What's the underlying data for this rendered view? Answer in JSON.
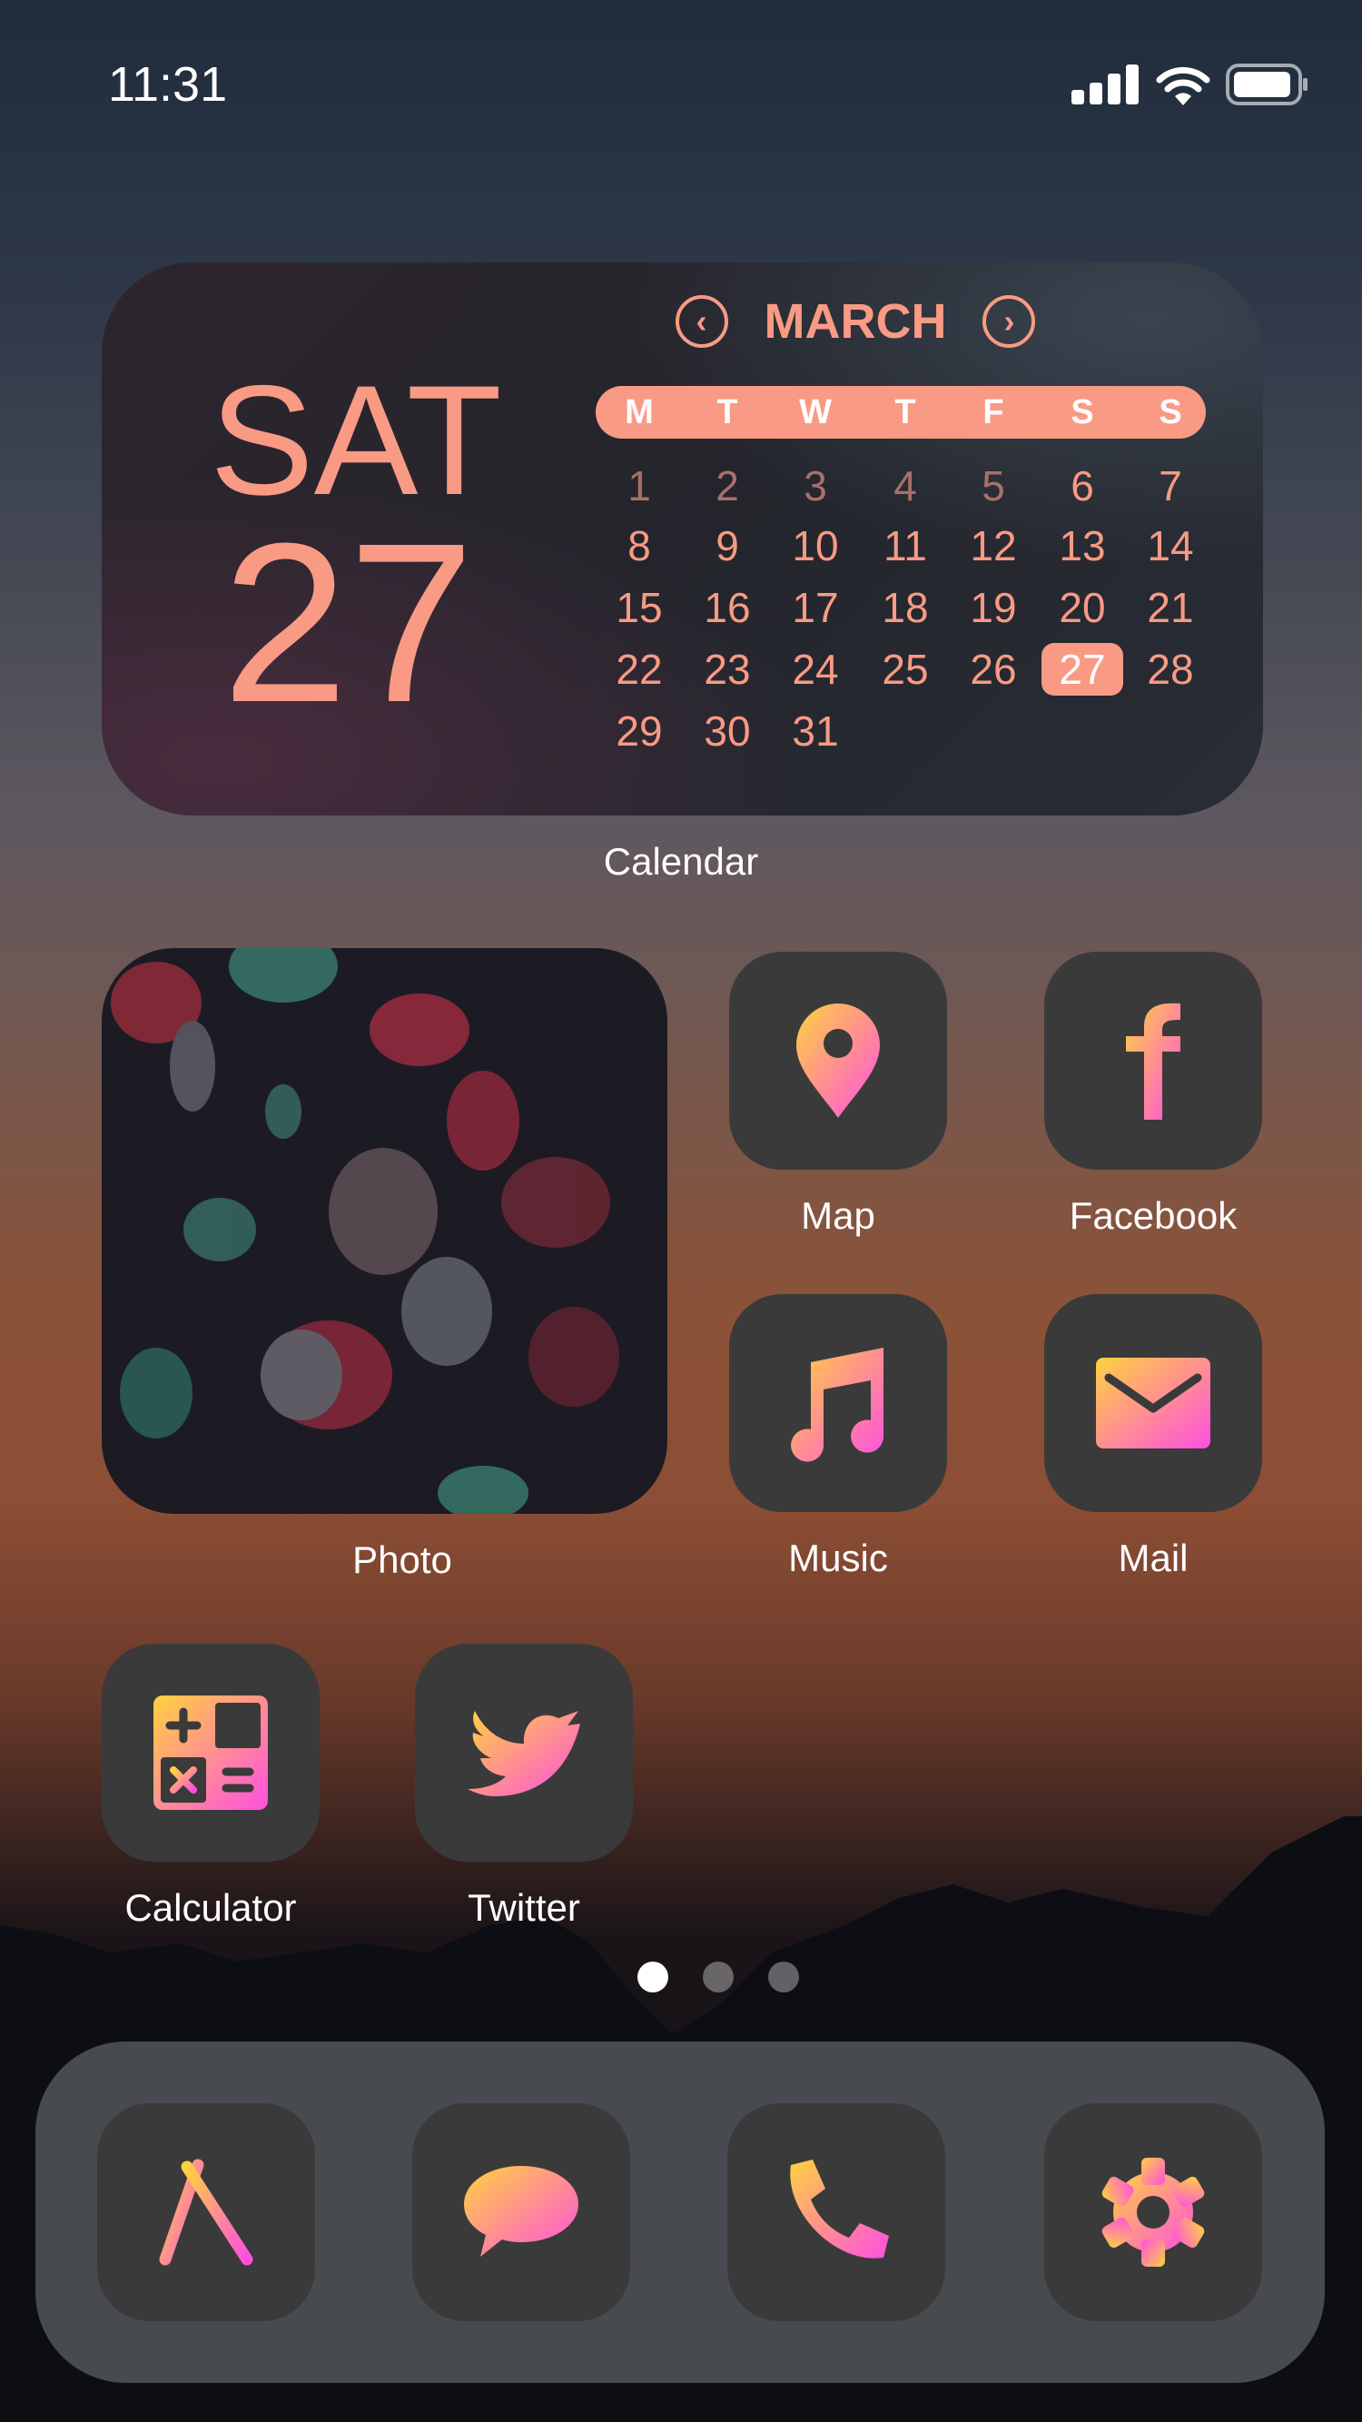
{
  "status": {
    "time": "11:31",
    "icons": [
      "cellular-signal-icon",
      "wifi-icon",
      "battery-icon"
    ]
  },
  "calendar": {
    "day_of_week": "SAT",
    "date": "27",
    "month": "MARCH",
    "prev_icon": "chevron-left-icon",
    "next_icon": "chevron-right-icon",
    "weekdays": [
      "M",
      "T",
      "W",
      "T",
      "F",
      "S",
      "S"
    ],
    "weeks": [
      [
        "1",
        "2",
        "3",
        "4",
        "5",
        "6",
        "7"
      ],
      [
        "8",
        "9",
        "10",
        "11",
        "12",
        "13",
        "14"
      ],
      [
        "15",
        "16",
        "17",
        "18",
        "19",
        "20",
        "21"
      ],
      [
        "22",
        "23",
        "24",
        "25",
        "26",
        "27",
        "28"
      ],
      [
        "29",
        "30",
        "31",
        "",
        "",
        "",
        ""
      ]
    ],
    "dimmed_days": [
      "1",
      "2",
      "3",
      "4",
      "5"
    ],
    "today": "27",
    "label": "Calendar",
    "accent": "#f99a84"
  },
  "photo": {
    "label": "Photo"
  },
  "apps": [
    {
      "label": "Map",
      "icon": "map-pin-icon"
    },
    {
      "label": "Facebook",
      "icon": "facebook-icon"
    },
    {
      "label": "Music",
      "icon": "music-note-icon"
    },
    {
      "label": "Mail",
      "icon": "mail-icon"
    },
    {
      "label": "Calculator",
      "icon": "calculator-icon"
    },
    {
      "label": "Twitter",
      "icon": "twitter-icon"
    }
  ],
  "page_dots": {
    "count": 3,
    "active": 1
  },
  "dock": [
    {
      "icon": "app-store-icon"
    },
    {
      "icon": "messages-icon"
    },
    {
      "icon": "phone-icon"
    },
    {
      "icon": "settings-icon"
    }
  ],
  "colors": {
    "gradient_start": "#ffd23f",
    "gradient_end": "#ff4fe0",
    "icon_bg": "#3a3a3a"
  }
}
